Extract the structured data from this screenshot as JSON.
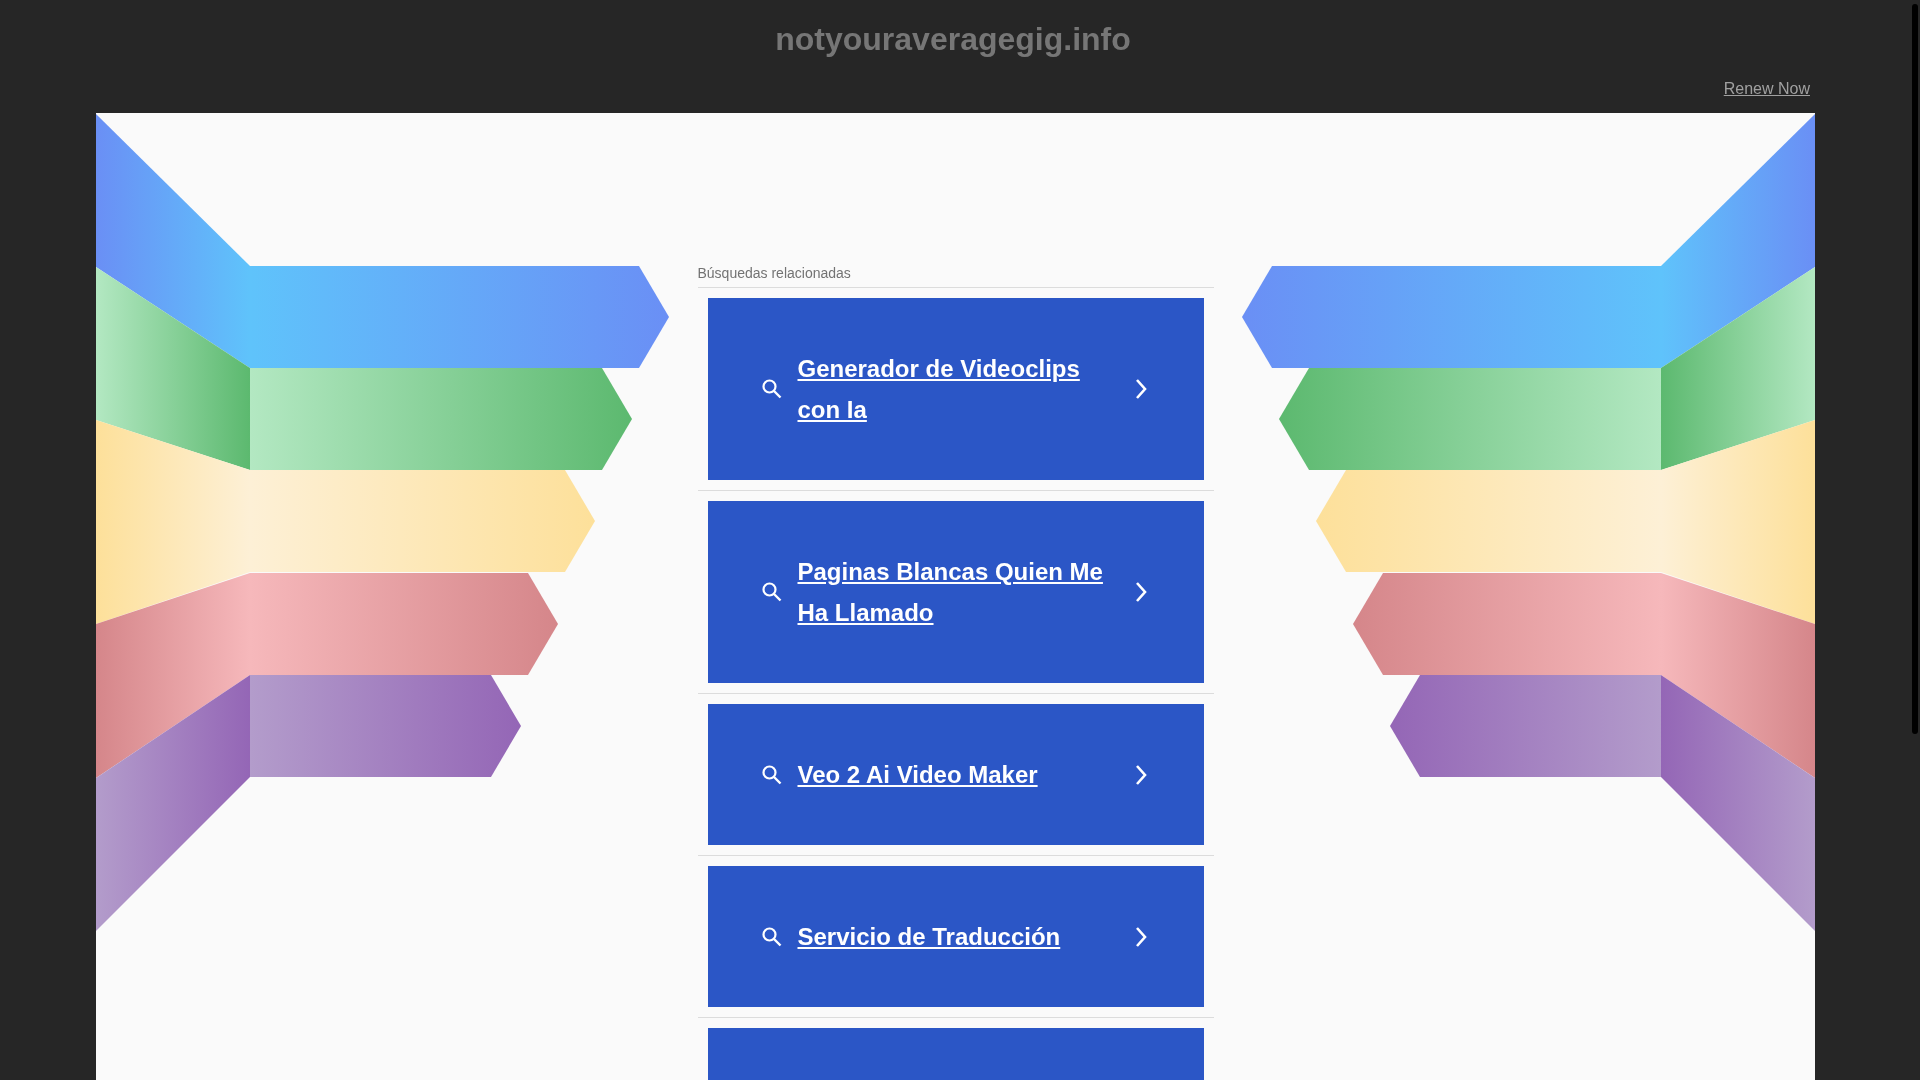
{
  "header": {
    "domain": "notyouraveragegig.info",
    "renew_link": "Renew Now"
  },
  "related": {
    "heading": "Búsquedas relacionadas",
    "links": [
      {
        "kind": "link",
        "label": "Generador de Videoclips con Ia"
      },
      {
        "kind": "link",
        "label": "Paginas Blancas Quien Me Ha Llamado"
      },
      {
        "kind": "link",
        "label": "Veo 2 Ai Video Maker"
      },
      {
        "kind": "link",
        "label": "Servicio de Traducción"
      },
      {
        "kind": "cut"
      }
    ]
  }
}
